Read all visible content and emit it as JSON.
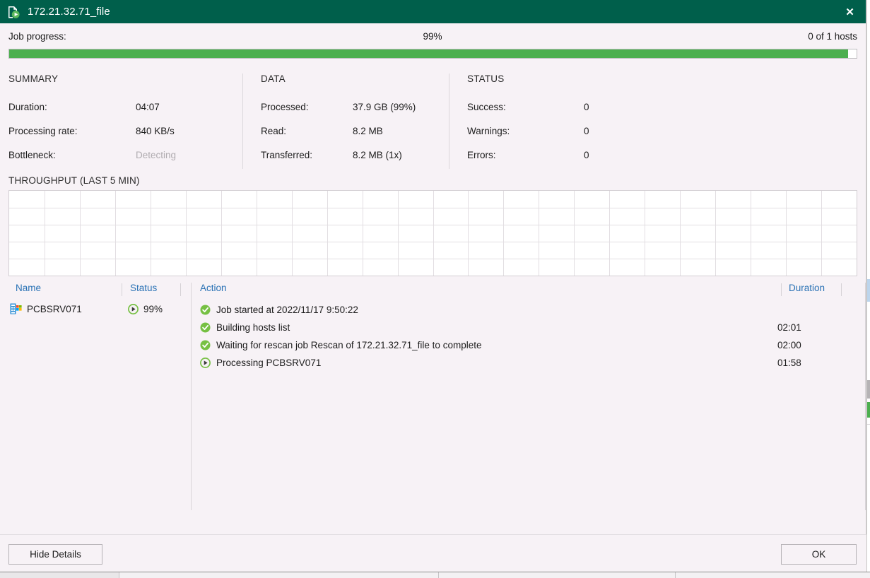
{
  "window": {
    "title": "172.21.32.71_file",
    "icon": "job-file-icon",
    "close_label": "✕",
    "titlebar_color": "#005f4b"
  },
  "progress": {
    "label": "Job progress:",
    "percent_text": "99%",
    "percent_value": 99,
    "hosts_text": "0 of 1 hosts"
  },
  "summary": {
    "heading": "SUMMARY",
    "rows": [
      {
        "key": "Duration:",
        "value": "04:07",
        "muted": false
      },
      {
        "key": "Processing rate:",
        "value": "840 KB/s",
        "muted": false
      },
      {
        "key": "Bottleneck:",
        "value": "Detecting",
        "muted": true
      }
    ]
  },
  "data_section": {
    "heading": "DATA",
    "rows": [
      {
        "key": "Processed:",
        "value": "37.9 GB (99%)",
        "muted": false
      },
      {
        "key": "Read:",
        "value": "8.2 MB",
        "muted": false
      },
      {
        "key": "Transferred:",
        "value": "8.2 MB (1x)",
        "muted": false
      }
    ]
  },
  "status_section": {
    "heading": "STATUS",
    "rows": [
      {
        "key": "Success:",
        "value": "0",
        "muted": false
      },
      {
        "key": "Warnings:",
        "value": "0",
        "muted": false
      },
      {
        "key": "Errors:",
        "value": "0",
        "muted": false
      }
    ]
  },
  "throughput": {
    "heading": "THROUGHPUT (LAST 5 MIN)",
    "columns": 24,
    "rows": 5
  },
  "list": {
    "headers": {
      "name": "Name",
      "status": "Status",
      "action": "Action",
      "duration": "Duration"
    },
    "entities": [
      {
        "icon": "server-icon",
        "name": "PCBSRV071",
        "status_icon": "in-progress-icon",
        "status": "99%"
      }
    ],
    "actions": [
      {
        "icon": "success-icon",
        "text": "Job started at 2022/11/17 9:50:22",
        "duration": ""
      },
      {
        "icon": "success-icon",
        "text": "Building hosts list",
        "duration": "02:01"
      },
      {
        "icon": "success-icon",
        "text": "Waiting for rescan job Rescan of 172.21.32.71_file to complete",
        "duration": "02:00"
      },
      {
        "icon": "in-progress-icon",
        "text": "Processing PCBSRV071",
        "duration": "01:58"
      }
    ]
  },
  "footer": {
    "hide_details_label": "Hide Details",
    "ok_label": "OK"
  },
  "colors": {
    "accent_green": "#4caf4f",
    "header_green": "#005f4b",
    "link_blue": "#2a72b5",
    "muted_gray": "#b0acb0"
  }
}
